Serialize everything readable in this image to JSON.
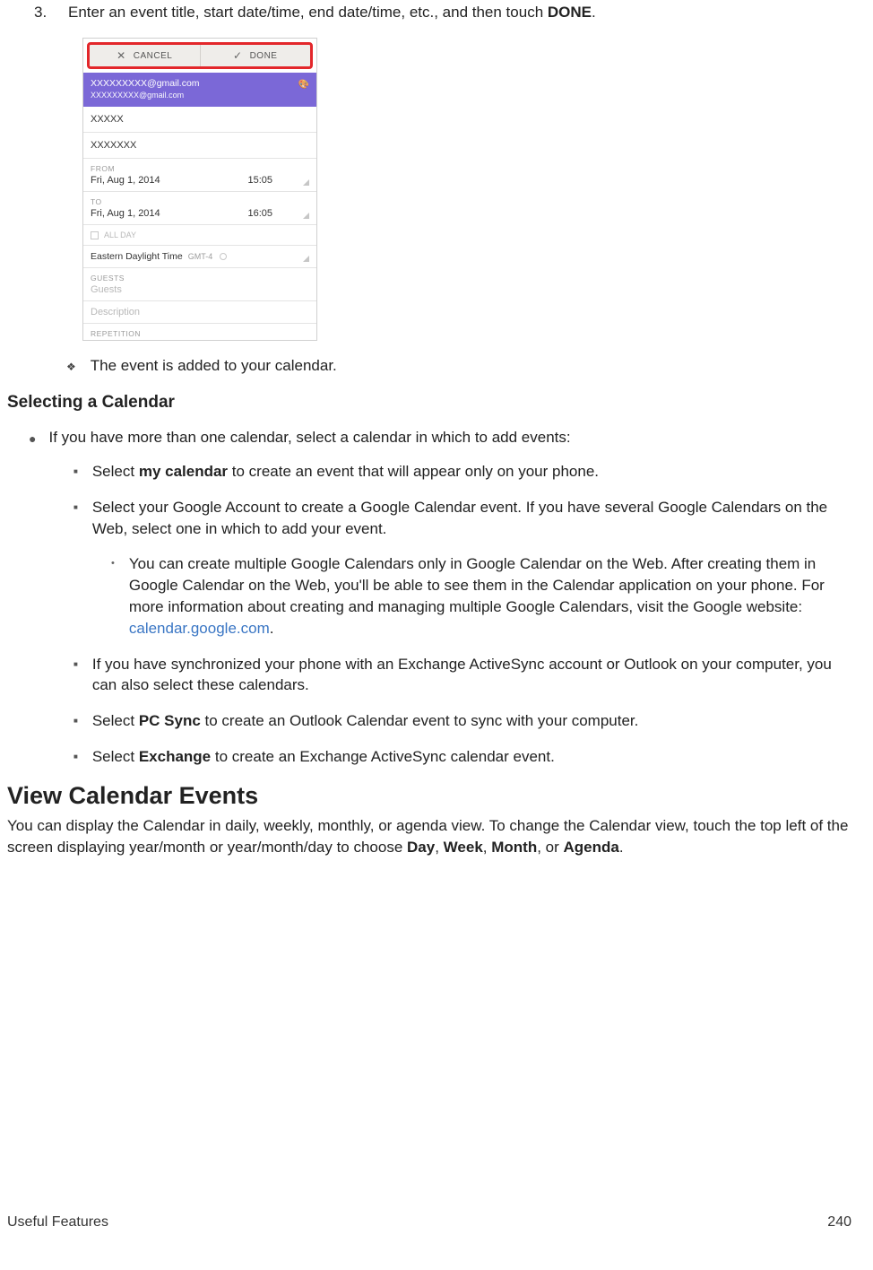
{
  "step": {
    "num": "3.",
    "text_a": "Enter an event title, start date/time, end date/time, etc., and then touch ",
    "text_bold": "DONE",
    "text_b": "."
  },
  "phone": {
    "cancel": "CANCEL",
    "done": "DONE",
    "account1": "XXXXXXXXX@gmail.com",
    "account2": "XXXXXXXXX@gmail.com",
    "title_value": "XXXXX",
    "location_value": "XXXXXXX",
    "from_label": "FROM",
    "from_date": "Fri, Aug 1, 2014",
    "from_time": "15:05",
    "to_label": "TO",
    "to_date": "Fri, Aug 1, 2014",
    "to_time": "16:05",
    "allday": "ALL DAY",
    "tz_main": "Eastern Daylight Time",
    "tz_sub": "GMT-4",
    "guests_label": "GUESTS",
    "guests_ph": "Guests",
    "desc_ph": "Description",
    "rep_label": "REPETITION"
  },
  "diamond_text": "The event is added to your calendar.",
  "subhead": "Selecting a Calendar",
  "dot_text": "If you have more than one calendar, select a calendar in which to add events:",
  "sq1": {
    "a": "Select ",
    "b": "my calendar",
    "c": " to create an event that will appear only on your phone."
  },
  "sq2": "Select your Google Account to create a Google Calendar event. If you have several Google Calendars on the Web, select one in which to add your event.",
  "tick": {
    "a": "You can create multiple Google Calendars only in Google Calendar on the Web. After creating them in Google Calendar on the Web, you'll be able to see them in the Calendar application on your phone. For more information about creating and managing multiple Google Calendars, visit the Google website: ",
    "link": "calendar.google.com",
    "b": "."
  },
  "sq3": "If you have synchronized your phone with an Exchange ActiveSync account or Outlook on your computer, you can also select these calendars.",
  "sq4": {
    "a": "Select ",
    "b": "PC Sync",
    "c": " to create an Outlook Calendar event to sync with your computer."
  },
  "sq5": {
    "a": "Select ",
    "b": "Exchange",
    "c": " to create an Exchange ActiveSync calendar event."
  },
  "bighead": "View Calendar Events",
  "para": {
    "a": "You can display the Calendar in daily, weekly, monthly, or agenda view. To change the Calendar view, touch the top left of the screen displaying year/month or year/month/day to choose ",
    "d": "Day",
    "sep1": ", ",
    "w": "Week",
    "sep2": ", ",
    "m": "Month",
    "sep3": ", or ",
    "ag": "Agenda",
    "end": "."
  },
  "footer": {
    "left": "Useful Features",
    "right": "240"
  }
}
